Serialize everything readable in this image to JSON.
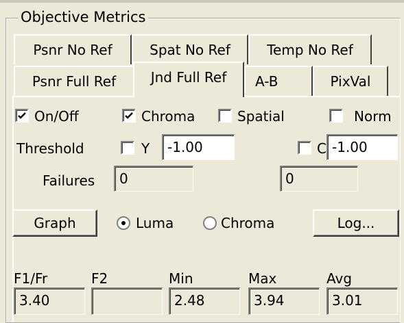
{
  "group": {
    "title": "Objective Metrics"
  },
  "tabs": [
    {
      "label": "Psnr No Ref",
      "selected": false
    },
    {
      "label": "Spat No Ref",
      "selected": false
    },
    {
      "label": "Temp No Ref",
      "selected": false
    },
    {
      "label": "Psnr Full Ref",
      "selected": false
    },
    {
      "label": "Jnd Full Ref",
      "selected": true
    },
    {
      "label": "A-B",
      "selected": false
    },
    {
      "label": "PixVal",
      "selected": false
    }
  ],
  "options": {
    "onoff": {
      "label": "On/Off",
      "checked": true
    },
    "chroma": {
      "label": "Chroma",
      "checked": true
    },
    "spatial": {
      "label": "Spatial",
      "checked": false
    },
    "norm": {
      "label": "Norm",
      "checked": false
    }
  },
  "threshold": {
    "label": "Threshold",
    "y_label": "Y",
    "y_checked": false,
    "y_value": "-1.00",
    "c_label": "C",
    "c_checked": false,
    "c_value": "-1.00"
  },
  "failures": {
    "label": "Failures",
    "y_value": "0",
    "c_value": "0"
  },
  "controls": {
    "graph_label": "Graph",
    "luma_label": "Luma",
    "chroma_label": "Chroma",
    "selected": "Luma",
    "log_label": "Log..."
  },
  "stats": {
    "headers": [
      "F1/Fr",
      "F2",
      "Min",
      "Max",
      "Avg"
    ],
    "values": [
      "3.40",
      "",
      "2.48",
      "3.94",
      "3.01"
    ]
  }
}
